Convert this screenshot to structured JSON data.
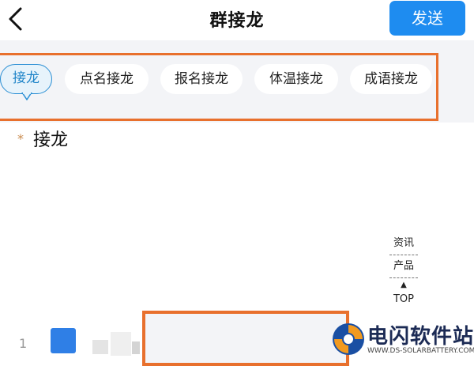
{
  "header": {
    "title": "群接龙",
    "send_label": "发送"
  },
  "chips": [
    {
      "label": "接龙",
      "active": true
    },
    {
      "label": "点名接龙",
      "active": false
    },
    {
      "label": "报名接龙",
      "active": false
    },
    {
      "label": "体温接龙",
      "active": false
    },
    {
      "label": "成语接龙",
      "active": false
    }
  ],
  "form": {
    "required_mark": "*",
    "field_label": "接龙"
  },
  "side_nav": {
    "news": "资讯",
    "products": "产品",
    "top_arrow": "▲",
    "top": "TOP"
  },
  "list": {
    "row_number": "1"
  },
  "watermark": {
    "title": "电闪软件站",
    "url": "WWW.DS-SOLARBATTERY.COM"
  },
  "colors": {
    "accent": "#1e8cf0",
    "highlight_box": "#e8702d",
    "active_chip_border": "#2b8fd4",
    "avatar": "#2f7fe6"
  }
}
